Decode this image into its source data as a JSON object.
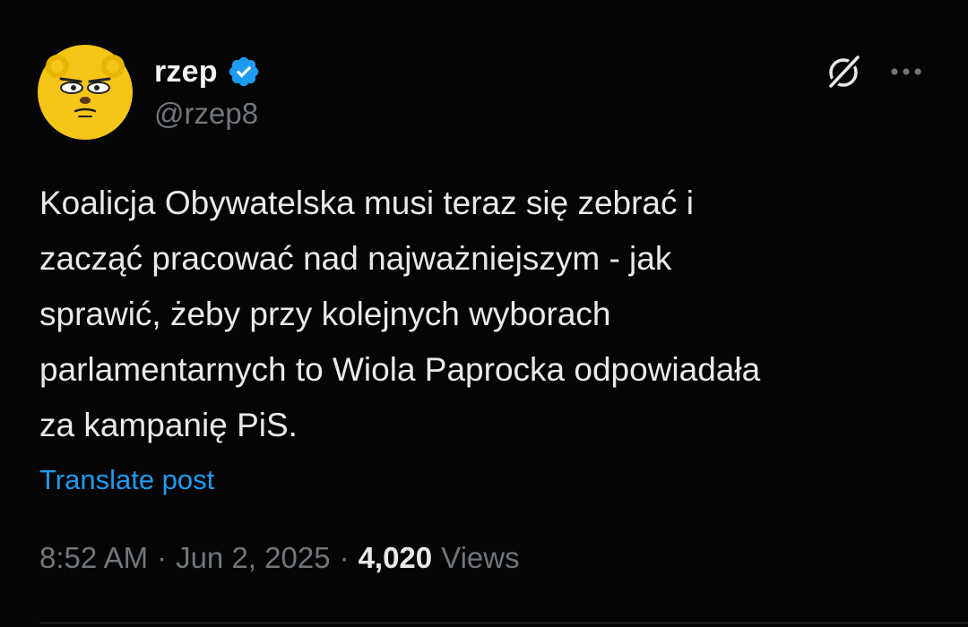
{
  "author": {
    "display_name": "rzep",
    "handle": "@rzep8",
    "verified": true,
    "avatar_icon": "cartoon-bear-avatar-icon"
  },
  "actions": {
    "grok_icon": "grok-icon",
    "more_icon": "more-options-icon"
  },
  "post": {
    "text": "Koalicja Obywatelska musi teraz się zebrać i\nzacząć pracować nad najważniejszym - jak\nsprawić, żeby przy kolejnych wyborach\nparlamentarnych to Wiola Paprocka odpowiadała\nza kampanię PiS.",
    "translate_label": "Translate post"
  },
  "meta": {
    "time": "8:52 AM",
    "separator": "·",
    "date": "Jun 2, 2025",
    "views_count": "4,020",
    "views_label": "Views"
  },
  "colors": {
    "background": "#050505",
    "text": "#e7e9ea",
    "secondary": "#71767b",
    "link": "#1d9bf0",
    "verified": "#1d9bf0",
    "avatar": "#f5c518"
  }
}
